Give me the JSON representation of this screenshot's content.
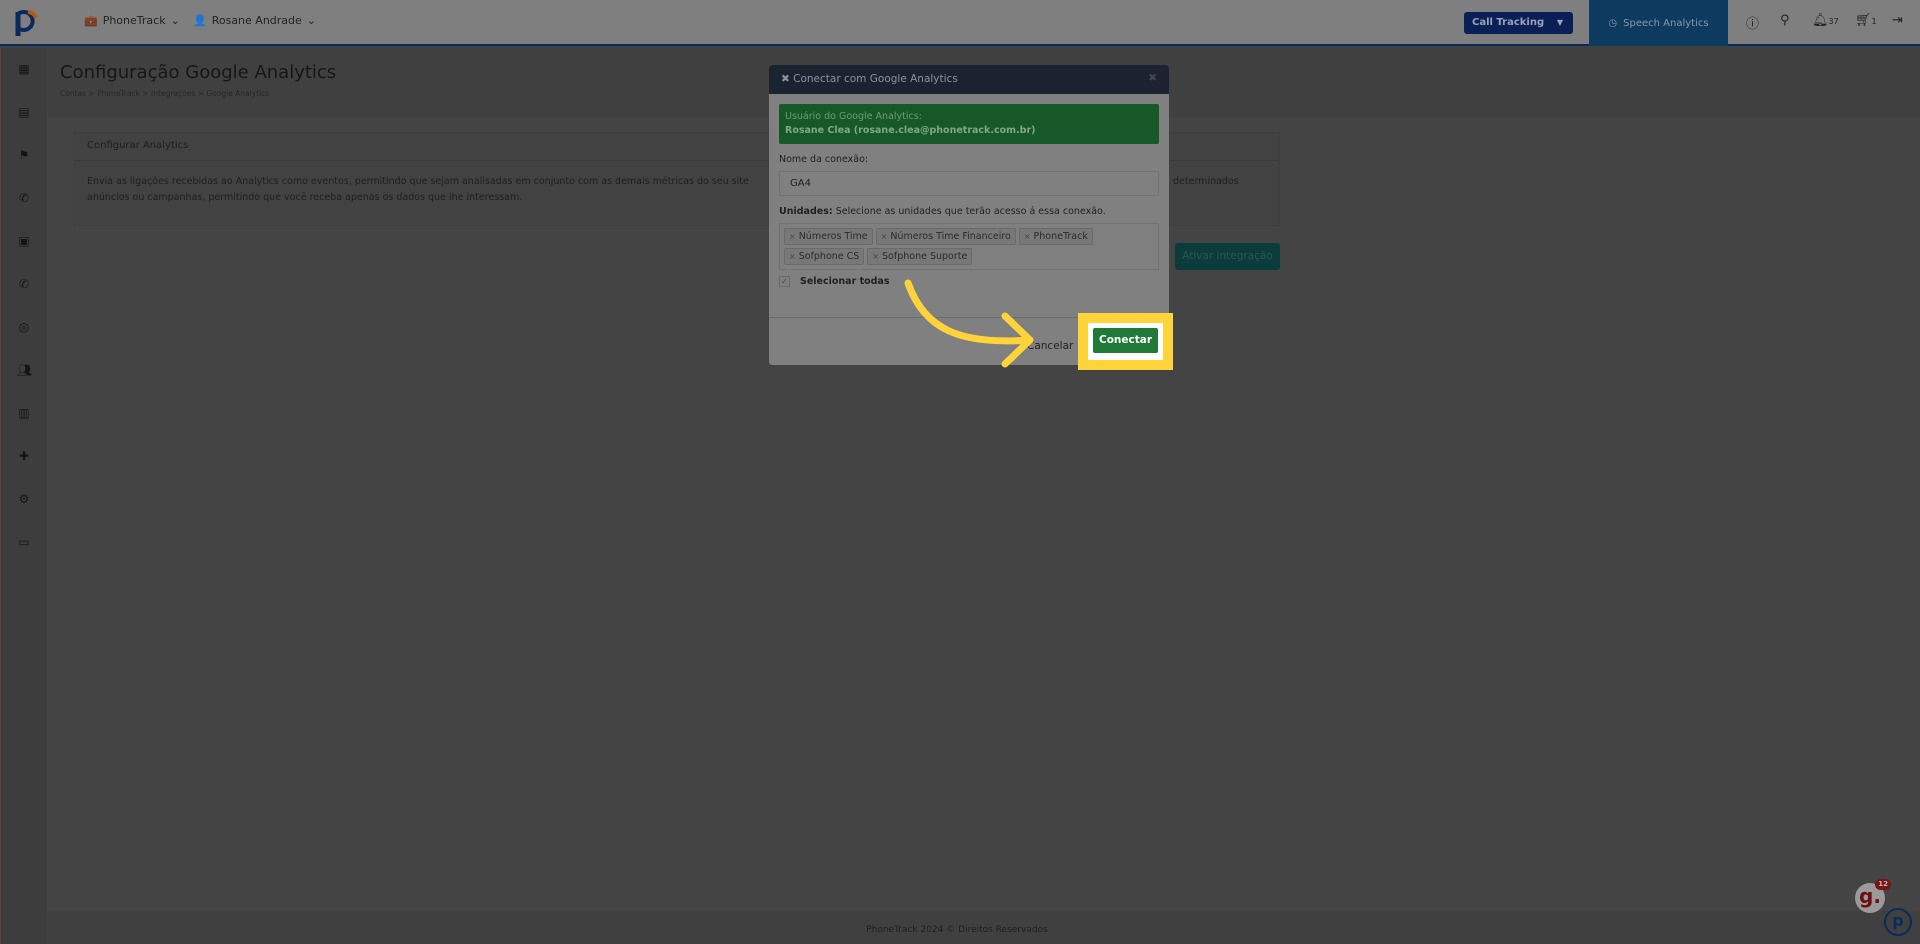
{
  "topbar": {
    "account": "PhoneTrack",
    "user": "Rosane Andrade",
    "product_select": "Call Tracking",
    "speech_analytics": "Speech Analytics",
    "notifications_count": "37",
    "cart_count": "1"
  },
  "page": {
    "title": "Configuração Google Analytics",
    "breadcrumb": [
      "Contas",
      ">",
      "PhoneTrack",
      ">",
      "Integrações",
      ">",
      "Google Analytics"
    ]
  },
  "card": {
    "header": "Configurar Analytics",
    "line1": "Envia as ligações recebidas ao Analytics como eventos, permitindo que sejam analisadas em conjunto com as demais métricas do seu site",
    "line1_end": "determinados",
    "line2": "anúncios ou campanhas, permitindo que você receba apenas os dados que lhe interessam.",
    "activate_button": "Ativar integração"
  },
  "modal": {
    "title": "Conectar com Google Analytics",
    "ga_user_label": "Usuário do Google Analytics:",
    "ga_user_value": "Rosane Clea (rosane.clea@phonetrack.com.br)",
    "connection_name_label": "Nome da conexão:",
    "connection_name_value": "GA4",
    "units_label": "Unidades:",
    "units_hint": "Selecione as unidades que terão acesso á essa conexão.",
    "units": [
      "Números Time",
      "Números Time Financeiro",
      "PhoneTrack",
      "Sofphone CS",
      "Sofphone Suporte"
    ],
    "select_all_label": "Selecionar todas",
    "select_all_checked": true,
    "cancel": "Cancelar",
    "connect": "Conectar"
  },
  "footer": {
    "text": "PhoneTrack 2024 © Direitos Reservados"
  },
  "widget": {
    "badge": "12",
    "letter": "g."
  },
  "colors": {
    "highlight": "#ffd43b",
    "connect": "#1e7a36",
    "header": "#1c2330"
  }
}
